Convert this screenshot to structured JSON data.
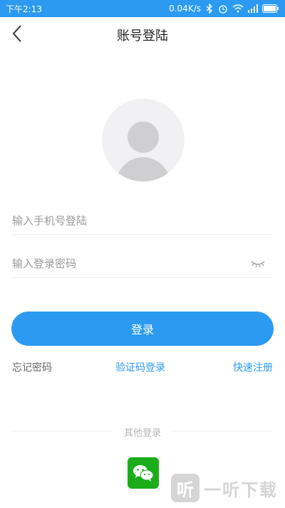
{
  "status_bar": {
    "time": "下午2:13",
    "speed": "0.04K/s",
    "icons": [
      "bluetooth-icon",
      "alarm-icon",
      "wifi-icon",
      "signal-icon",
      "battery-icon"
    ]
  },
  "nav": {
    "back_icon": "chevron-left-icon",
    "title": "账号登陆"
  },
  "form": {
    "phone_placeholder": "输入手机号登陆",
    "password_placeholder": "输入登录密码",
    "eye_icon": "eye-closed-icon"
  },
  "login_button": "登录",
  "links": {
    "forgot": "忘记密码",
    "code_login": "验证码登录",
    "quick_register": "快速注册"
  },
  "other_login": {
    "label": "其他登录",
    "wechat_icon": "wechat-icon"
  },
  "watermark": {
    "mark": "听",
    "text": "一听下载"
  },
  "colors": {
    "accent": "#2b9af0",
    "wechat": "#1aad19"
  }
}
